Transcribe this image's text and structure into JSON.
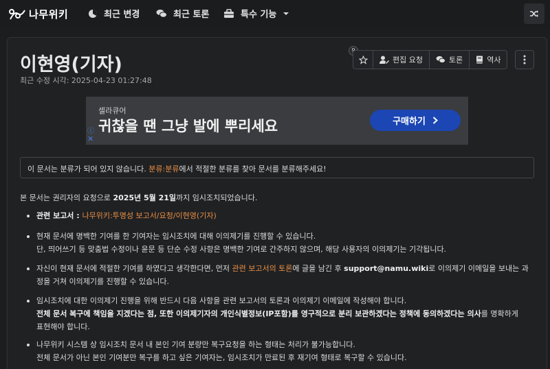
{
  "topbar": {
    "logo_text": "나무위키",
    "nav": [
      {
        "icon": "compass-icon",
        "label": "최근 변경"
      },
      {
        "icon": "chat-bubbles-icon",
        "label": "최근 토론"
      },
      {
        "icon": "toolbox-icon",
        "label": "특수 기능"
      }
    ]
  },
  "page": {
    "title": "이현영(기자)",
    "meta": "최근 수정 시각: 2025-04-23 01:27:48",
    "star_count": "9",
    "toolbar": {
      "edit_request": "편집 요청",
      "discussion": "토론",
      "history": "역사"
    }
  },
  "ad": {
    "brand": "셀라큐어",
    "headline": "귀찮을 땐 그냥 발에 뿌리세요",
    "cta": "구매하기",
    "info": "ⓘ",
    "close": "✕"
  },
  "notice": {
    "pre": "이 문서는 분류가 되어 있지 않습니다. ",
    "link": "분류:분류",
    "post": "에서 적절한 분류를 찾아 문서를 분류해주세요!"
  },
  "body": {
    "intro_pre": "본 문서는 권리자의 요청으로 ",
    "intro_bold": "2025년 5월 21일",
    "intro_post": "까지 임시조치되었습니다.",
    "item1_label": "관련 보고서 : ",
    "item1_link": "나무위키:투명성 보고서/요청/이현영(기자)",
    "item2_line1": "현재 문서에 명백한 기여를 한 기여자는 임시조치에 대해 이의제기를 진행할 수 있습니다.",
    "item2_line2": "단, 띄어쓰기 등 맞춤법 수정이나 윤문 등 단순 수정 사항은 명백한 기여로 간주하지 않으며, 해당 사용자의 이의제기는 기각됩니다.",
    "item3_pre": "자신이 현재 문서에 적절한 기여를 하였다고 생각한다면, 먼저 ",
    "item3_link": "관련 보고서의 토론",
    "item3_mid": "에 글을 남긴 후 ",
    "item3_email": "support@namu.wiki",
    "item3_post": "로 이의제기 이메일을 보내는 과",
    "item3_line2": "정을 거쳐 이의제기를 진행할 수 있습니다.",
    "item4_line1": "임시조치에 대한 이의제기 진행을 위해 반드시 다음 사항을 관련 보고서의 토론과 이의제기 이메일에 작성해야 합니다.",
    "item4_bold": "전체 문서 복구에 책임을 지겠다는 점, 또한 이의제기자의 개인식별정보(IP포함)를 영구적으로 분리 보관하겠다는 정책에 동의하겠다는 의사",
    "item4_post": "를 명확하게",
    "item4_line3": "표현해야 합니다.",
    "item5_line1": "나무위키 시스템 상 임시조치 문서 내 본인 기여 분량만 복구요청을 하는 형태는 처리가 불가능합니다.",
    "item5_line2": "전체 문서가 아닌 본인 기여분만 복구를 하고 싶은 기여자는, 임시조치가 만료된 후 재기여 형태로 복구할 수 있습니다."
  },
  "colors": {
    "background": "#1c1d1f",
    "link": "#e88f45",
    "cta": "#1b46b4"
  }
}
